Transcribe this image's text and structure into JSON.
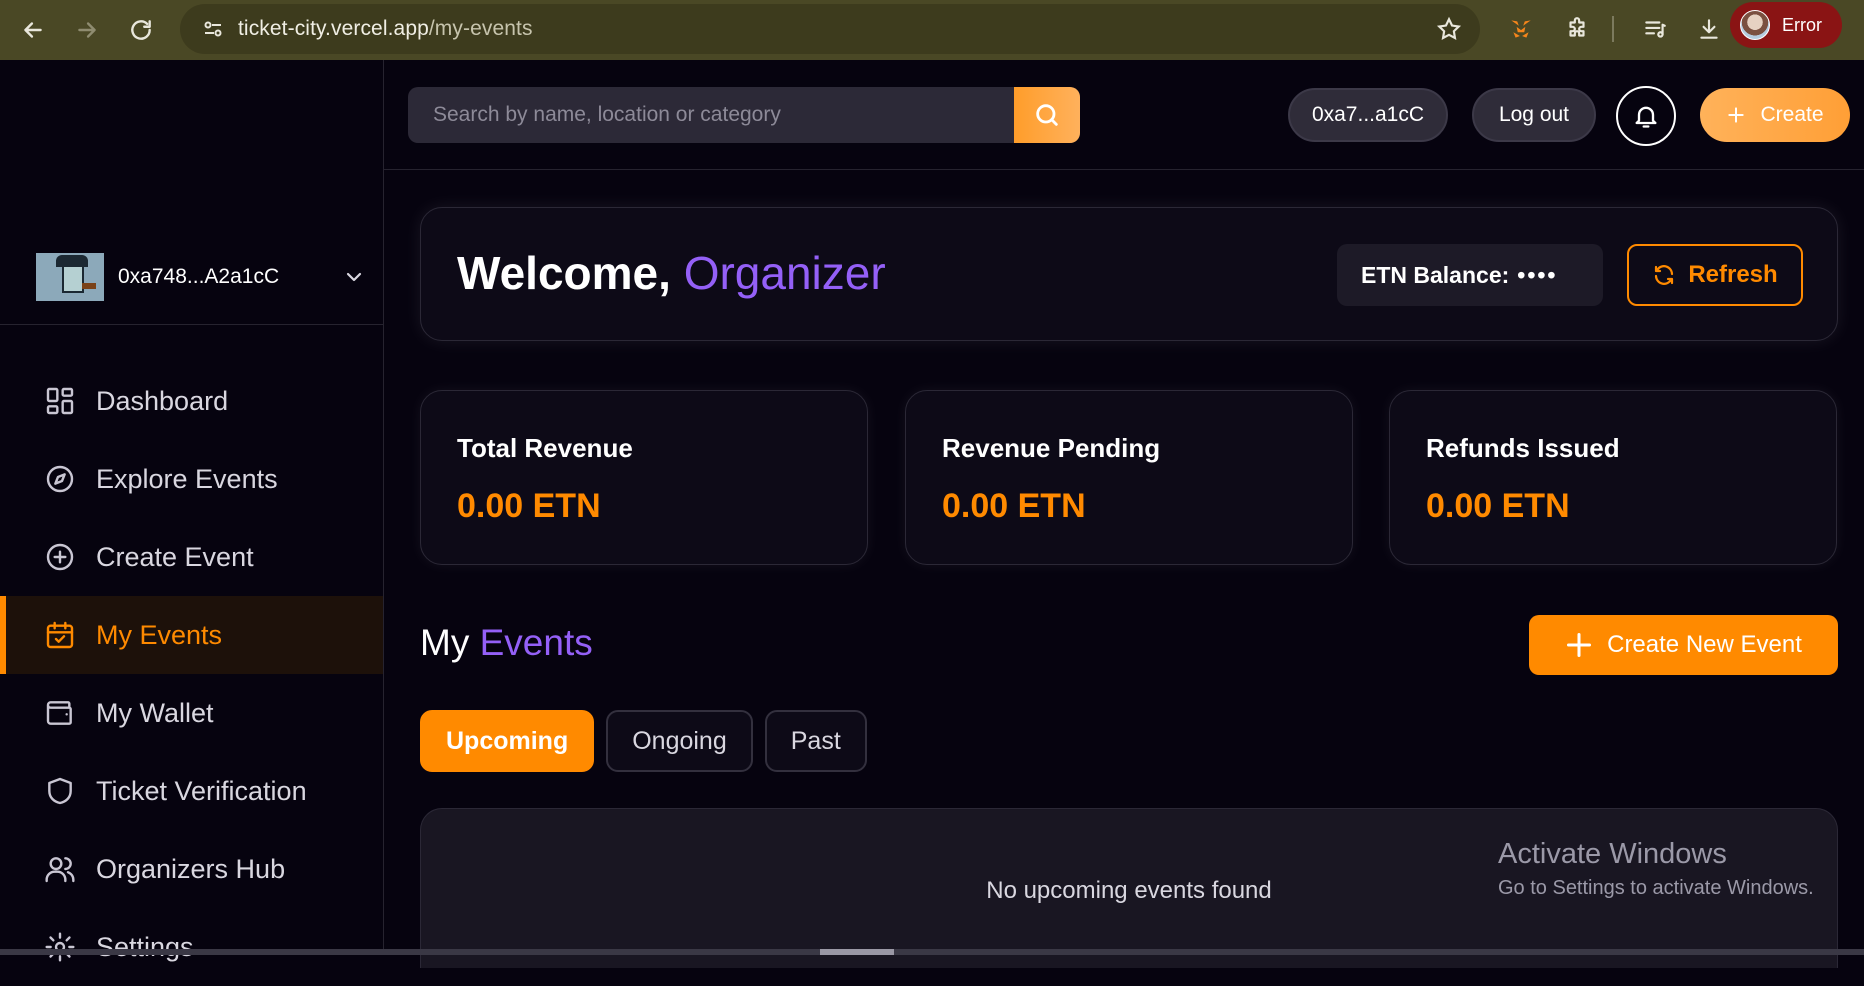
{
  "browser": {
    "url_host": "ticket-city.vercel.app",
    "url_path": "/my-events",
    "profile_status": "Error"
  },
  "sidebar": {
    "user_address": "0xa748...A2a1cC",
    "items": [
      {
        "label": "Dashboard",
        "icon": "dashboard-icon"
      },
      {
        "label": "Explore Events",
        "icon": "compass-icon"
      },
      {
        "label": "Create Event",
        "icon": "plus-circle-icon"
      },
      {
        "label": "My Events",
        "icon": "calendar-check-icon",
        "active": true
      },
      {
        "label": "My Wallet",
        "icon": "wallet-icon"
      },
      {
        "label": "Ticket Verification",
        "icon": "shield-icon"
      },
      {
        "label": "Organizers Hub",
        "icon": "users-icon"
      },
      {
        "label": "Settings",
        "icon": "gear-icon"
      }
    ]
  },
  "topbar": {
    "search_placeholder": "Search by name, location or category",
    "wallet_short": "0xa7...a1cC",
    "logout_label": "Log out",
    "create_label": "Create"
  },
  "welcome": {
    "prefix": "Welcome, ",
    "name": "Organizer",
    "balance_label": "ETN Balance:",
    "balance_masked": "••••",
    "refresh_label": "Refresh"
  },
  "stats": [
    {
      "label": "Total Revenue",
      "value": "0.00 ETN"
    },
    {
      "label": "Revenue Pending",
      "value": "0.00 ETN"
    },
    {
      "label": "Refunds Issued",
      "value": "0.00 ETN"
    }
  ],
  "events": {
    "title_prefix": "My ",
    "title_accent": "Events",
    "create_new_label": "Create New Event",
    "tabs": [
      "Upcoming",
      "Ongoing",
      "Past"
    ],
    "active_tab": "Upcoming",
    "empty_message": "No upcoming events found"
  },
  "watermark": {
    "line1": "Activate Windows",
    "line2": "Go to Settings to activate Windows."
  },
  "colors": {
    "accent_orange": "#ff8a00",
    "accent_purple": "#9460f7",
    "background": "#06030f"
  }
}
